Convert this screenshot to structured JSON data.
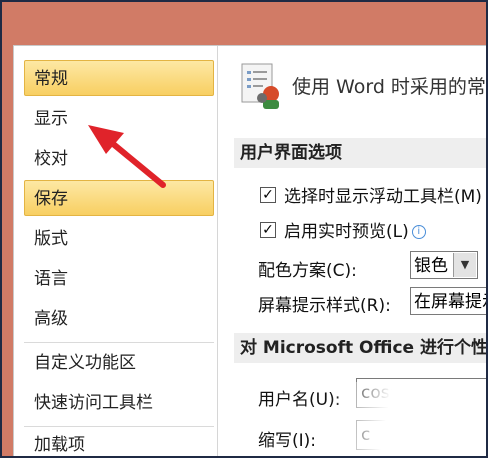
{
  "sidebar": {
    "items": [
      {
        "label": "常规",
        "selected": true
      },
      {
        "label": "显示",
        "selected": false
      },
      {
        "label": "校对",
        "selected": false
      },
      {
        "label": "保存",
        "selected": true
      },
      {
        "label": "版式",
        "selected": false
      },
      {
        "label": "语言",
        "selected": false
      },
      {
        "label": "高级",
        "selected": false
      },
      {
        "label": "自定义功能区",
        "selected": false
      },
      {
        "label": "快速访问工具栏",
        "selected": false
      },
      {
        "label": "加载项",
        "selected": false
      }
    ]
  },
  "content": {
    "heading": "使用 Word 时采用的常",
    "ui_section": {
      "title": "用户界面选项",
      "mini_toolbar": {
        "checked": true,
        "label": "选择时显示浮动工具栏(M)"
      },
      "live_preview": {
        "checked": true,
        "label": "启用实时预览(L)"
      },
      "color_scheme": {
        "label": "配色方案(C):",
        "value": "银色"
      },
      "screentip": {
        "label": "屏幕提示样式(R):",
        "value": "在屏幕提示"
      }
    },
    "personalize_section": {
      "title": "对 Microsoft Office 进行个性",
      "username": {
        "label": "用户名(U):",
        "value": "cosmi"
      },
      "initials": {
        "label": "缩写(I):",
        "value": "c"
      }
    }
  },
  "annotation": {
    "color": "#e0232a"
  },
  "icons": {
    "options": "options-document-icon",
    "info": "info-icon"
  }
}
